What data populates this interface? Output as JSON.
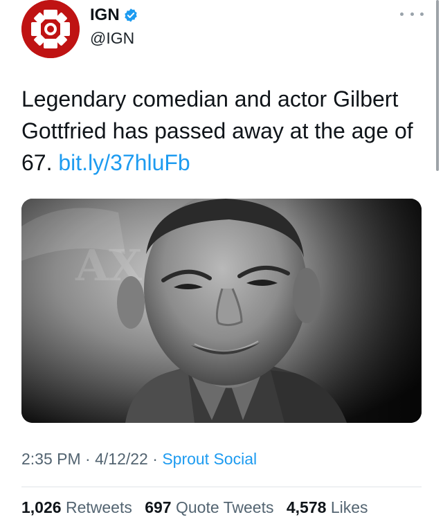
{
  "account": {
    "display_name": "IGN",
    "handle": "@IGN",
    "verified": true,
    "avatar_icon": "ign-logo-icon",
    "brand_color": "#bf1313"
  },
  "tweet": {
    "text": "Legendary comedian and actor Gilbert Gottfried has passed away at the age of 67.",
    "link": "bit.ly/37hluFb",
    "link_color": "#1d9bf0",
    "media_icon": "portrait-photo"
  },
  "meta": {
    "time": "2:35 PM",
    "date": "4/12/22",
    "source": "Sprout Social",
    "separator": "·"
  },
  "stats": {
    "retweets_count": "1,026",
    "retweets_label": "Retweets",
    "quote_count": "697",
    "quote_label": "Quote Tweets",
    "likes_count": "4,578",
    "likes_label": "Likes"
  }
}
